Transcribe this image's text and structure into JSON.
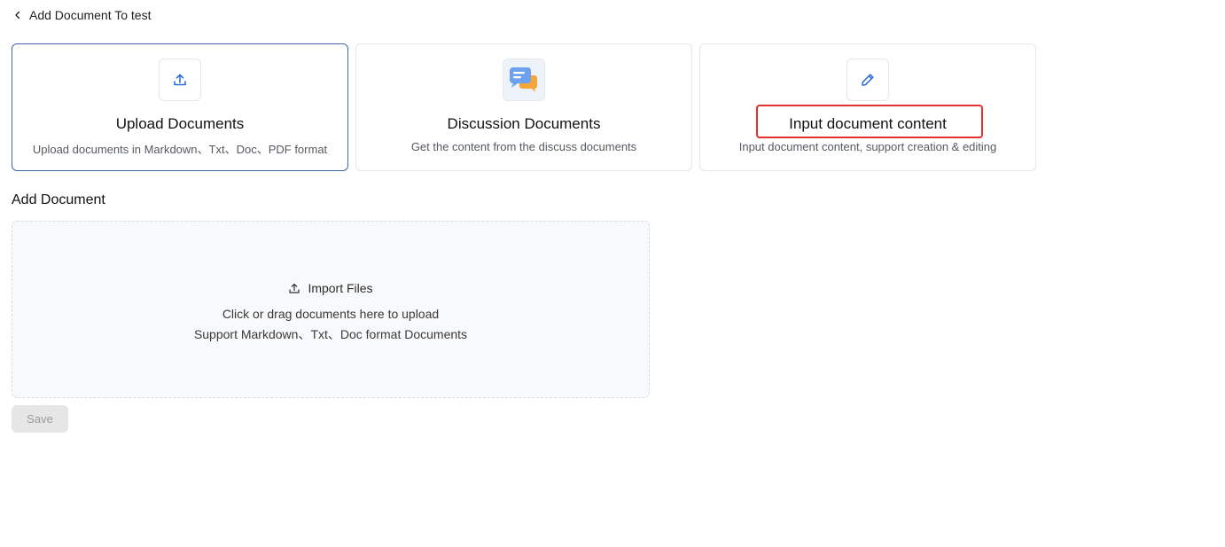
{
  "header": {
    "title": "Add Document To test",
    "back_icon": "chevron-left-icon"
  },
  "source_cards": [
    {
      "title": "Upload Documents",
      "description": "Upload documents in Markdown、Txt、Doc、PDF format",
      "icon": "upload-icon",
      "selected": true
    },
    {
      "title": "Discussion Documents",
      "description": "Get the content from the discuss documents",
      "icon": "chat-bubbles-icon",
      "selected": false
    },
    {
      "title": "Input document content",
      "description": "Input document content, support creation & editing",
      "icon": "pencil-icon",
      "selected": false,
      "highlighted": true
    }
  ],
  "add_document": {
    "section_title": "Add Document",
    "import_label": "Import Files",
    "hint_line1": "Click or drag documents here to upload",
    "hint_line2": "Support Markdown、Txt、Doc format Documents"
  },
  "actions": {
    "save_label": "Save",
    "save_disabled": true
  },
  "colors": {
    "accent": "#3f67a8",
    "highlight": "#e0312f",
    "icon_blue": "#2f6bd8"
  }
}
